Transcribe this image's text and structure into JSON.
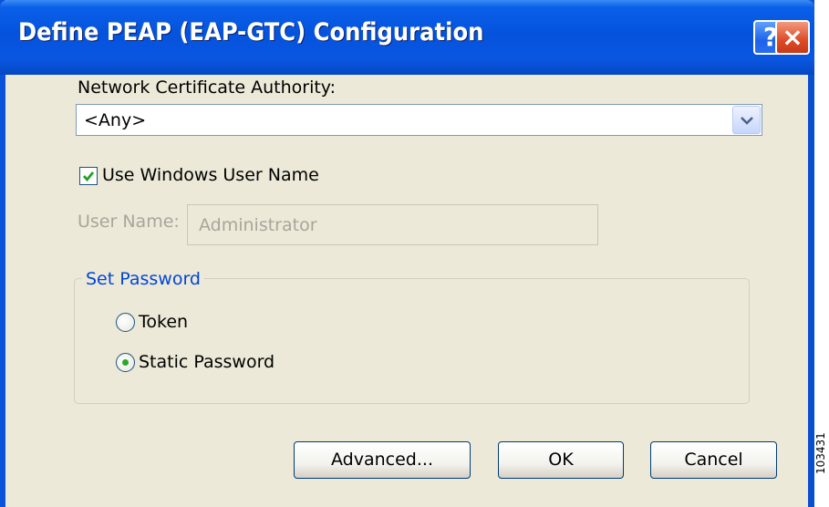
{
  "window": {
    "title": "Define PEAP (EAP-GTC) Configuration",
    "help_glyph": "?",
    "close_glyph": "×"
  },
  "certificate": {
    "label": "Network Certificate Authority:",
    "selected": "<Any>"
  },
  "windows_user": {
    "label": "Use Windows User Name",
    "checked": true
  },
  "username": {
    "label": "User Name:",
    "value": "Administrator",
    "enabled": false
  },
  "password_group": {
    "label": "Set Password",
    "options": [
      {
        "label": "Token",
        "selected": false
      },
      {
        "label": "Static Password",
        "selected": true
      }
    ]
  },
  "buttons": {
    "advanced": "Advanced...",
    "ok": "OK",
    "cancel": "Cancel"
  },
  "side_code": "103431",
  "colors": {
    "titlebar": "#0553dd",
    "dialog_bg": "#ece9d8",
    "group_label": "#0046d5",
    "disabled_text": "#a7a69a"
  }
}
